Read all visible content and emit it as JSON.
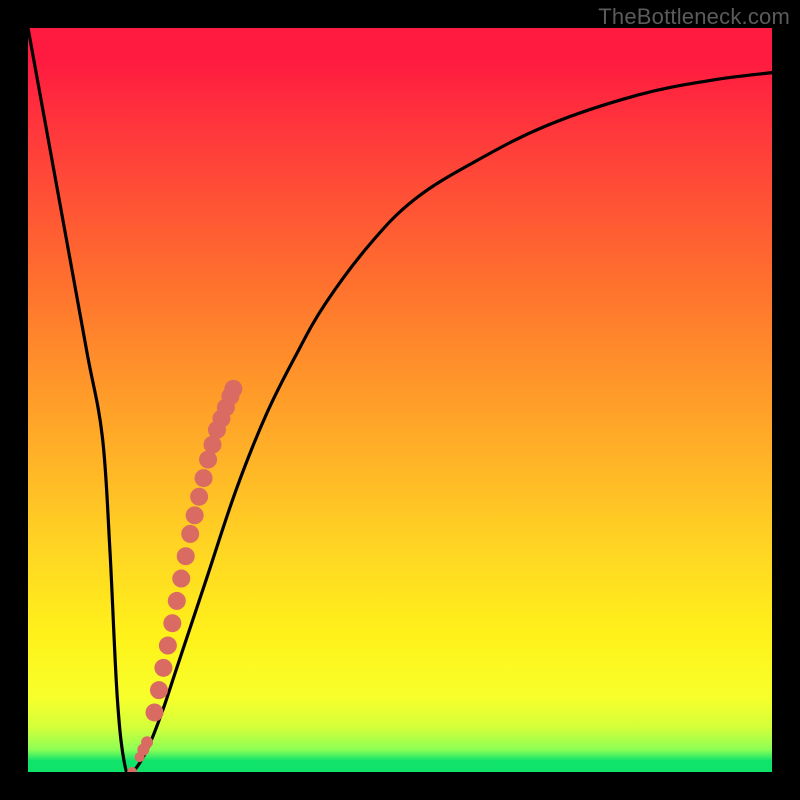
{
  "watermark": "TheBottleneck.com",
  "colors": {
    "frame": "#000000",
    "gradient_top": "#ff1a40",
    "gradient_mid1": "#ff8f2a",
    "gradient_mid2": "#fff21a",
    "gradient_bottom": "#0fe36a",
    "curve_stroke": "#000000",
    "marker_fill": "#d96b63"
  },
  "chart_data": {
    "type": "line",
    "title": "",
    "xlabel": "",
    "ylabel": "",
    "xlim": [
      0,
      100
    ],
    "ylim": [
      0,
      100
    ],
    "series": [
      {
        "name": "bottleneck-curve",
        "x": [
          0,
          2,
          4,
          6,
          8,
          10,
          11,
          12,
          13,
          14,
          16,
          18,
          20,
          24,
          28,
          32,
          36,
          40,
          46,
          52,
          60,
          70,
          82,
          92,
          100
        ],
        "y": [
          100,
          89,
          78,
          67,
          56,
          45,
          30,
          10,
          1,
          0,
          3,
          8,
          14,
          26,
          38,
          48,
          56,
          63,
          71,
          77,
          82,
          87,
          91,
          93,
          94
        ]
      }
    ],
    "markers": {
      "name": "highlight-dots",
      "x": [
        14.0,
        15.0,
        15.5,
        16.0,
        17.0,
        17.6,
        18.2,
        18.8,
        19.4,
        20.0,
        20.6,
        21.2,
        21.8,
        22.4,
        23.0,
        23.6,
        24.2,
        24.8,
        25.4,
        26.0,
        26.6,
        27.2,
        27.6
      ],
      "y": [
        0.0,
        2.0,
        3.0,
        4.0,
        8.0,
        11.0,
        14.0,
        17.0,
        20.0,
        23.0,
        26.0,
        29.0,
        32.0,
        34.5,
        37.0,
        39.5,
        42.0,
        44.0,
        46.0,
        47.5,
        49.0,
        50.5,
        51.5
      ]
    }
  }
}
